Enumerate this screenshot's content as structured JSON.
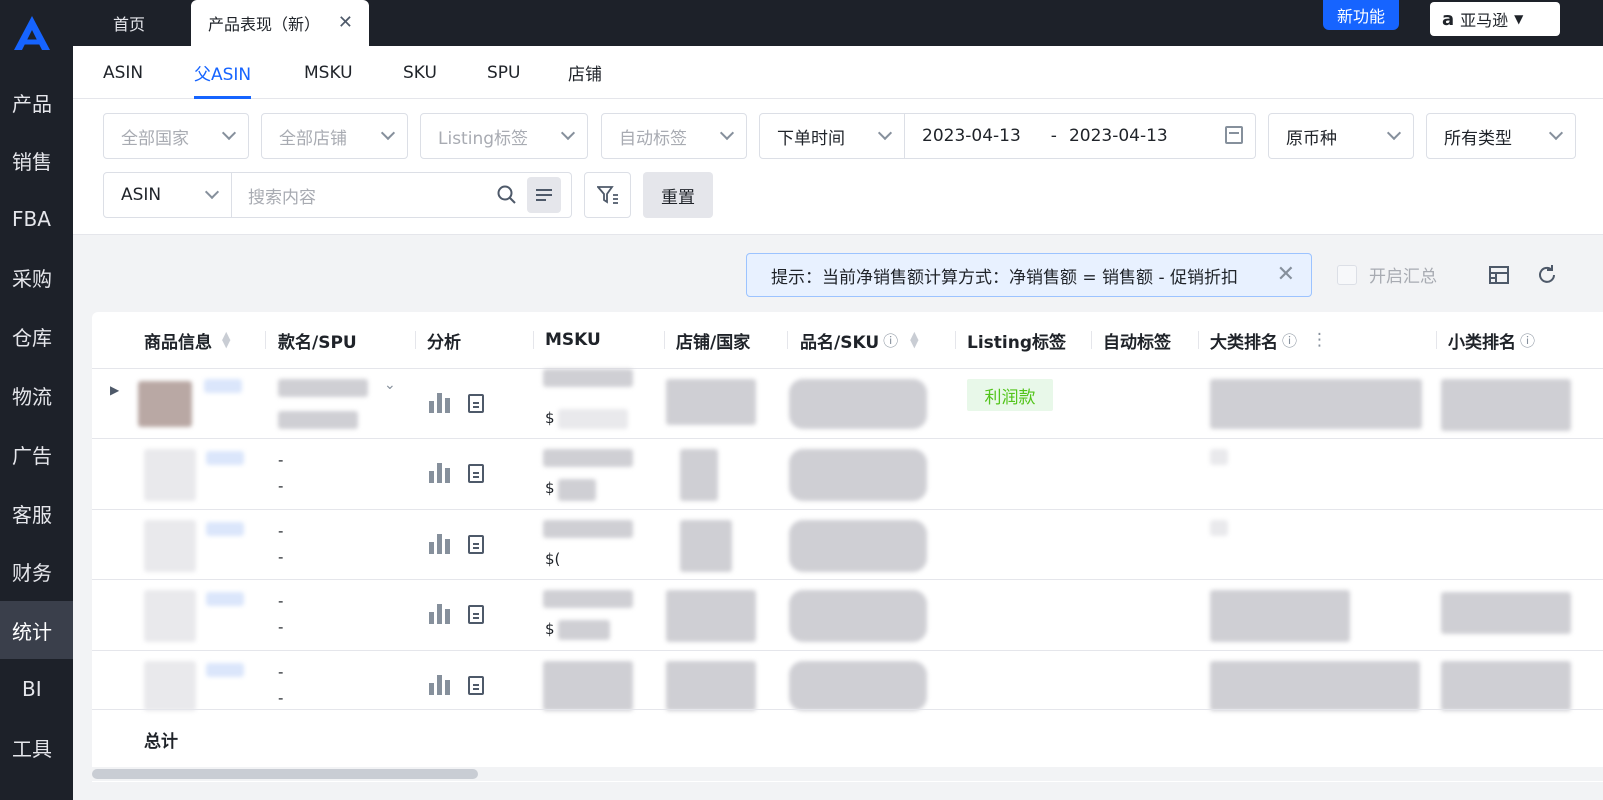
{
  "sidebar": {
    "items": [
      {
        "label": "产品"
      },
      {
        "label": "销售"
      },
      {
        "label": "FBA"
      },
      {
        "label": "采购"
      },
      {
        "label": "仓库"
      },
      {
        "label": "物流"
      },
      {
        "label": "广告"
      },
      {
        "label": "客服"
      },
      {
        "label": "财务"
      },
      {
        "label": "统计"
      },
      {
        "label": "BI"
      },
      {
        "label": "工具"
      }
    ],
    "active": "统计"
  },
  "topbar": {
    "tabs": [
      {
        "label": "首页"
      },
      {
        "label": "产品表现（新）"
      }
    ],
    "new_feature": "新功能",
    "store": "亚马逊"
  },
  "subtabs": [
    "ASIN",
    "父ASIN",
    "MSKU",
    "SKU",
    "SPU",
    "店铺"
  ],
  "filters": {
    "country": "全部国家",
    "shop": "全部店铺",
    "listing_tag": "Listing标签",
    "auto_tag": "自动标签",
    "time_type": "下单时间",
    "date_start": "2023-04-13",
    "date_sep": "-",
    "date_end": "2023-04-13",
    "currency": "原币种",
    "type": "所有类型",
    "search_field": "ASIN",
    "search_placeholder": "搜索内容",
    "reset": "重置"
  },
  "hint": "提示：当前净销售额计算方式：净销售额 = 销售额 - 促销折扣",
  "summary_toggle": "开启汇总",
  "table": {
    "columns": [
      "商品信息",
      "款名/SPU",
      "分析",
      "MSKU",
      "店铺/国家",
      "品名/SKU",
      "Listing标签",
      "自动标签",
      "大类排名",
      "小类排名"
    ],
    "rows": [
      {
        "spu_a": "",
        "spu_b": "",
        "price": "$",
        "tag": "利润款"
      },
      {
        "spu_a": "-",
        "spu_b": "-",
        "price": "$",
        "tag": ""
      },
      {
        "spu_a": "-",
        "spu_b": "-",
        "price": "$(",
        "tag": ""
      },
      {
        "spu_a": "-",
        "spu_b": "-",
        "price": "$",
        "tag": ""
      },
      {
        "spu_a": "-",
        "spu_b": "-",
        "price": "",
        "tag": ""
      }
    ],
    "total_label": "总计"
  }
}
